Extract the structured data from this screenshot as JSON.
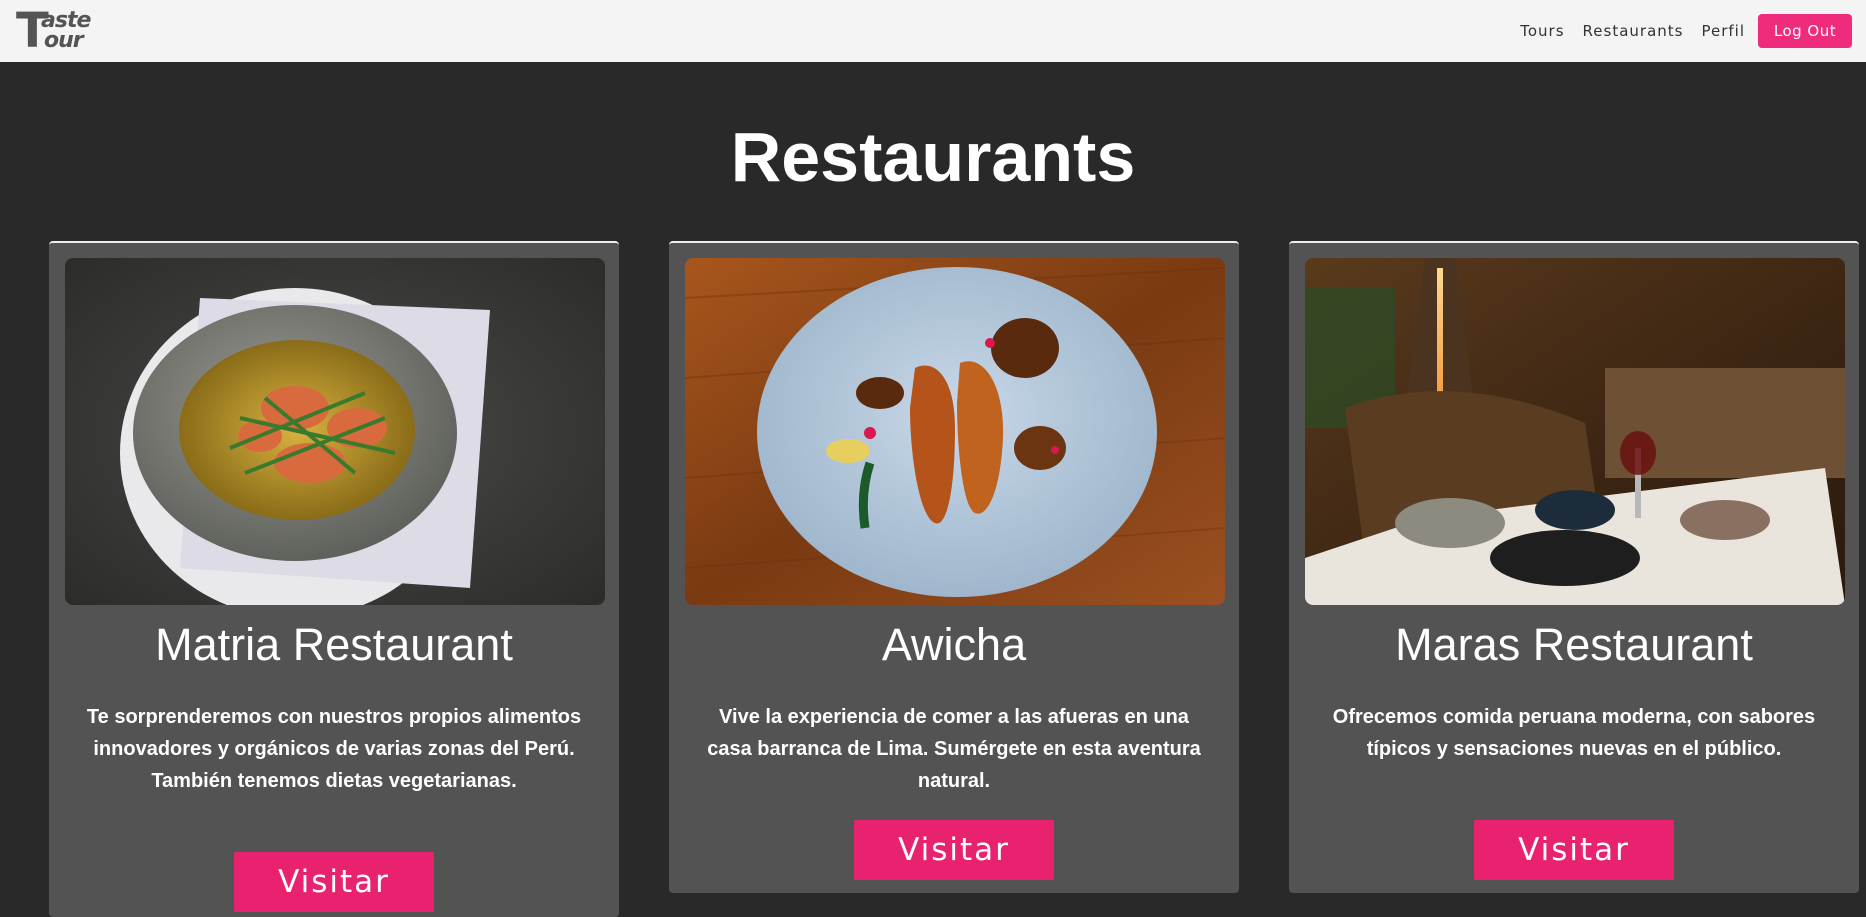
{
  "nav": {
    "logo": {
      "letter": "T",
      "line1": "aste",
      "line2": "our"
    },
    "links": [
      "Tours",
      "Restaurants",
      "Perfil"
    ],
    "logout_label": "Log Out"
  },
  "page": {
    "title": "Restaurants"
  },
  "restaurants": [
    {
      "name": "Matria Restaurant",
      "description": "Te sorprenderemos con nuestros propios alimentos innovadores y orgánicos de varias zonas del Perú. También tenemos dietas vegetarianas.",
      "button_label": "Visitar",
      "image": "stone-bowl-shrimp-dish-photo"
    },
    {
      "name": "Awicha",
      "description": "Vive la experiencia de comer a las afueras en una casa barranca de Lima. Sumérgete en esta aventura natural.",
      "button_label": "Visitar",
      "image": "glazed-meat-plate-photo"
    },
    {
      "name": "Maras Restaurant",
      "description": "Ofrecemos comida peruana moderna, con sabores típicos y sensaciones nuevas en el público.",
      "button_label": "Visitar",
      "image": "restaurant-table-photo"
    }
  ],
  "colors": {
    "accent": "#e8226f",
    "background": "#292929",
    "card": "#535353",
    "navbar": "#f4f4f4"
  }
}
